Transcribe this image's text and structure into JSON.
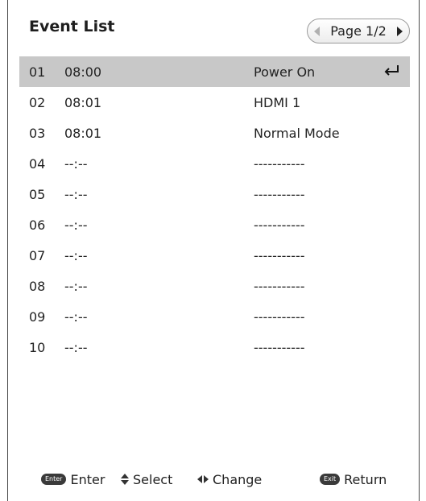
{
  "title": "Event List",
  "pager": {
    "label": "Page 1/2"
  },
  "events": [
    {
      "index": "01",
      "time": "08:00",
      "action": "Power On",
      "selected": true
    },
    {
      "index": "02",
      "time": "08:01",
      "action": "HDMI 1"
    },
    {
      "index": "03",
      "time": "08:01",
      "action": "Normal Mode"
    },
    {
      "index": "04",
      "time": "--:--",
      "action": "-----------"
    },
    {
      "index": "05",
      "time": "--:--",
      "action": "-----------"
    },
    {
      "index": "06",
      "time": "--:--",
      "action": "-----------"
    },
    {
      "index": "07",
      "time": "--:--",
      "action": "-----------"
    },
    {
      "index": "08",
      "time": "--:--",
      "action": "-----------"
    },
    {
      "index": "09",
      "time": "--:--",
      "action": "-----------"
    },
    {
      "index": "10",
      "time": "--:--",
      "action": "-----------"
    }
  ],
  "footer": {
    "enter_key": "Enter",
    "enter_label": "Enter",
    "select_label": "Select",
    "change_label": "Change",
    "exit_key": "Exit",
    "return_label": "Return"
  },
  "colors": {
    "selected_row": "#c8c8c8",
    "border": "#4a4a4a"
  },
  "icons": [
    "enter-return-icon",
    "arrow-left-icon",
    "arrow-right-icon",
    "up-down-icon",
    "left-right-icon"
  ]
}
